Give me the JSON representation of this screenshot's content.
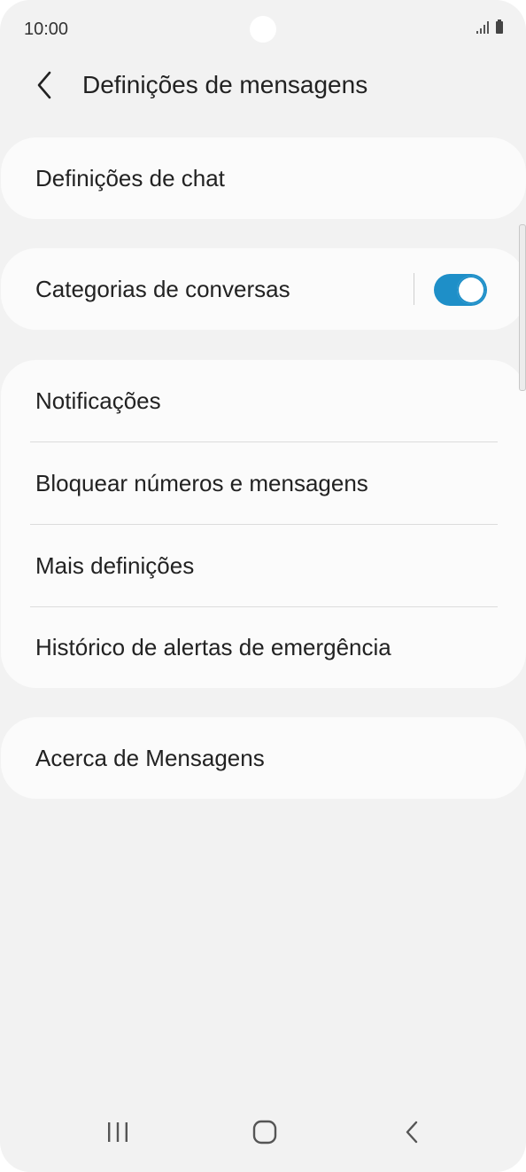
{
  "status_bar": {
    "time": "10:00",
    "icons": [
      "signal-icon",
      "battery-icon"
    ]
  },
  "header": {
    "back_icon": "chevron-left-icon",
    "title": "Definições de mensagens"
  },
  "groups": [
    {
      "items": [
        {
          "label": "Definições de chat"
        }
      ]
    },
    {
      "items": [
        {
          "label": "Categorias de conversas",
          "toggle": true
        }
      ]
    },
    {
      "items": [
        {
          "label": "Notificações"
        },
        {
          "label": "Bloquear números e mensagens"
        },
        {
          "label": "Mais definições"
        },
        {
          "label": "Histórico de alertas de emergência"
        }
      ]
    },
    {
      "items": [
        {
          "label": "Acerca de Mensagens"
        }
      ]
    }
  ],
  "colors": {
    "background": "#f2f2f2",
    "card": "#fbfbfb",
    "accent": "#1e8fc8",
    "text": "#222222"
  },
  "navbar": {
    "icons": [
      "recent-apps-icon",
      "home-icon",
      "back-icon"
    ]
  }
}
